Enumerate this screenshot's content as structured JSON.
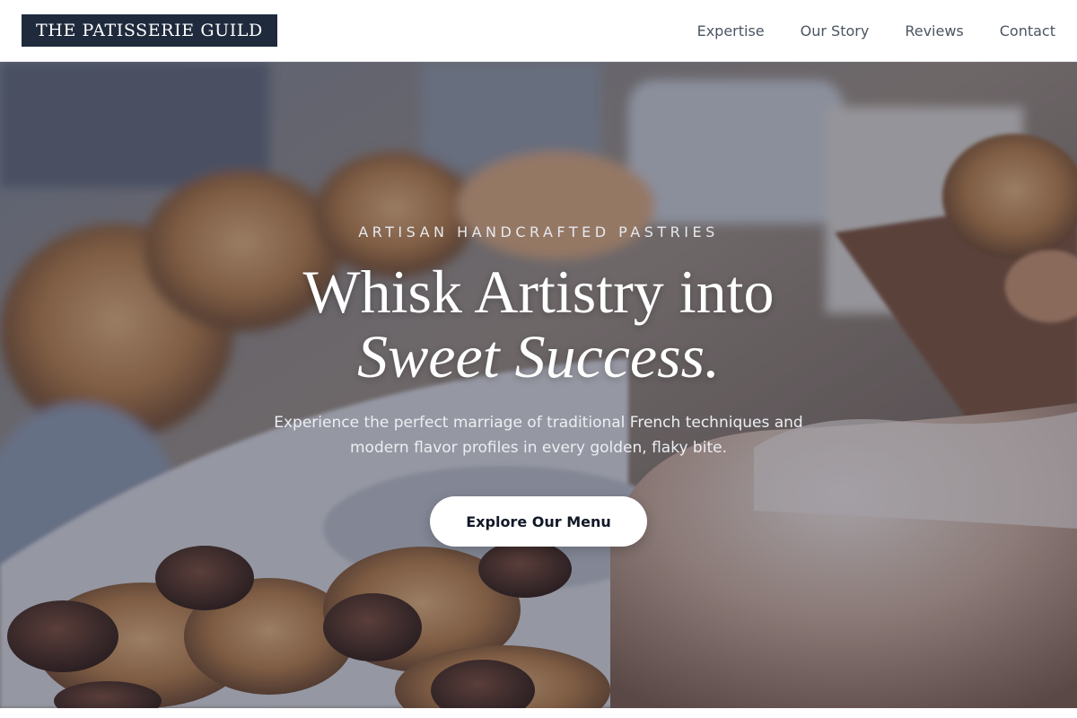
{
  "header": {
    "logo_text": "THE PATISSERIE GUILD",
    "nav": [
      {
        "label": "Expertise"
      },
      {
        "label": "Our Story"
      },
      {
        "label": "Reviews"
      },
      {
        "label": "Contact"
      }
    ]
  },
  "hero": {
    "eyebrow": "ARTISAN HANDCRAFTED PASTRIES",
    "headline_line1": "Whisk Artistry into",
    "headline_line2": "Sweet Success.",
    "subtext": "Experience the perfect marriage of traditional French techniques and modern flavor profiles in every golden, flaky bite.",
    "cta_label": "Explore Our Menu",
    "background_description": "bakery display of croissants, chocolate-topped pastries and powdered-sugar cake"
  },
  "colors": {
    "logo_bg": "#1f2a3c",
    "overlay": "#282e42",
    "nav_text": "#4b5563",
    "cta_bg": "#ffffff"
  }
}
